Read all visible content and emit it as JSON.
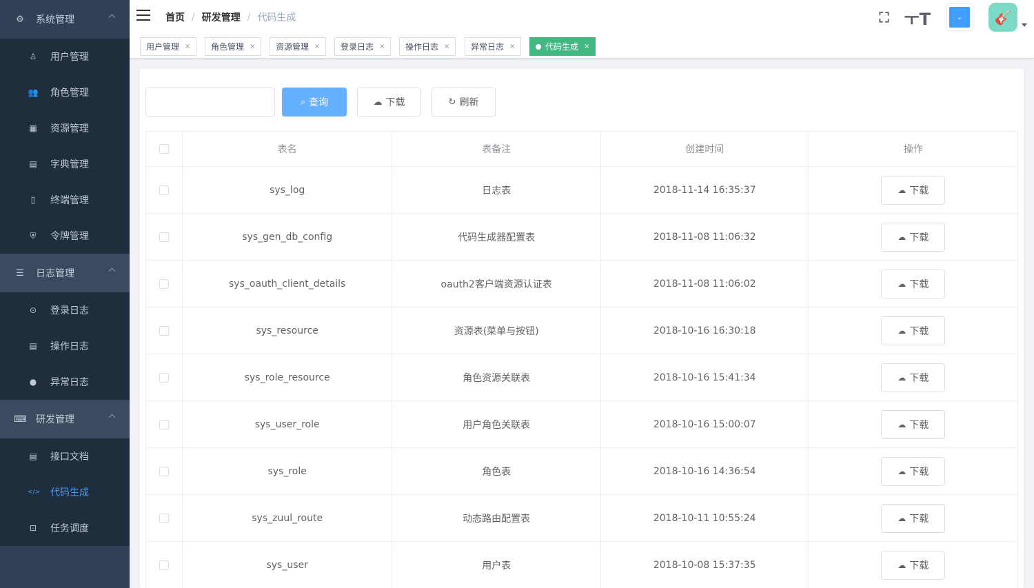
{
  "sidebar": {
    "groups": [
      {
        "title": "系统管理",
        "icon": "gear-icon",
        "items": [
          {
            "label": "用户管理",
            "icon": "user-icon"
          },
          {
            "label": "角色管理",
            "icon": "people-icon"
          },
          {
            "label": "资源管理",
            "icon": "grid-icon"
          },
          {
            "label": "字典管理",
            "icon": "book-icon"
          },
          {
            "label": "终端管理",
            "icon": "phone-icon"
          },
          {
            "label": "令牌管理",
            "icon": "shield-icon"
          }
        ]
      },
      {
        "title": "日志管理",
        "icon": "document-icon",
        "items": [
          {
            "label": "登录日志",
            "icon": "login-icon"
          },
          {
            "label": "操作日志",
            "icon": "clipboard-icon"
          },
          {
            "label": "异常日志",
            "icon": "warning-icon"
          }
        ]
      },
      {
        "title": "研发管理",
        "icon": "keyboard-icon",
        "items": [
          {
            "label": "接口文档",
            "icon": "file-icon"
          },
          {
            "label": "代码生成",
            "icon": "code-icon",
            "active": true
          },
          {
            "label": "任务调度",
            "icon": "schedule-icon"
          }
        ]
      }
    ]
  },
  "navbar": {
    "breadcrumb": [
      "首页",
      "研发管理",
      "代码生成"
    ],
    "separator": "/",
    "theme_color": "#409eff"
  },
  "tags": [
    {
      "label": "用户管理"
    },
    {
      "label": "角色管理"
    },
    {
      "label": "资源管理"
    },
    {
      "label": "登录日志"
    },
    {
      "label": "操作日志"
    },
    {
      "label": "异常日志"
    },
    {
      "label": "代码生成",
      "active": true
    }
  ],
  "toolbar": {
    "search_value": "",
    "search_placeholder": "",
    "query_label": "查询",
    "download_label": "下载",
    "refresh_label": "刷新"
  },
  "table": {
    "headers": [
      "表名",
      "表备注",
      "创建时间",
      "操作"
    ],
    "action_label": "下载",
    "rows": [
      {
        "name": "sys_log",
        "comment": "日志表",
        "created": "2018-11-14 16:35:37"
      },
      {
        "name": "sys_gen_db_config",
        "comment": "代码生成器配置表",
        "created": "2018-11-08 11:06:32"
      },
      {
        "name": "sys_oauth_client_details",
        "comment": "oauth2客户端资源认证表",
        "created": "2018-11-08 11:06:02"
      },
      {
        "name": "sys_resource",
        "comment": "资源表(菜单与按钮)",
        "created": "2018-10-16 16:30:18"
      },
      {
        "name": "sys_role_resource",
        "comment": "角色资源关联表",
        "created": "2018-10-16 15:41:34"
      },
      {
        "name": "sys_user_role",
        "comment": "用户角色关联表",
        "created": "2018-10-16 15:00:07"
      },
      {
        "name": "sys_role",
        "comment": "角色表",
        "created": "2018-10-16 14:36:54"
      },
      {
        "name": "sys_zuul_route",
        "comment": "动态路由配置表",
        "created": "2018-10-11 10:55:24"
      },
      {
        "name": "sys_user",
        "comment": "用户表",
        "created": "2018-10-08 15:37:35"
      }
    ]
  }
}
